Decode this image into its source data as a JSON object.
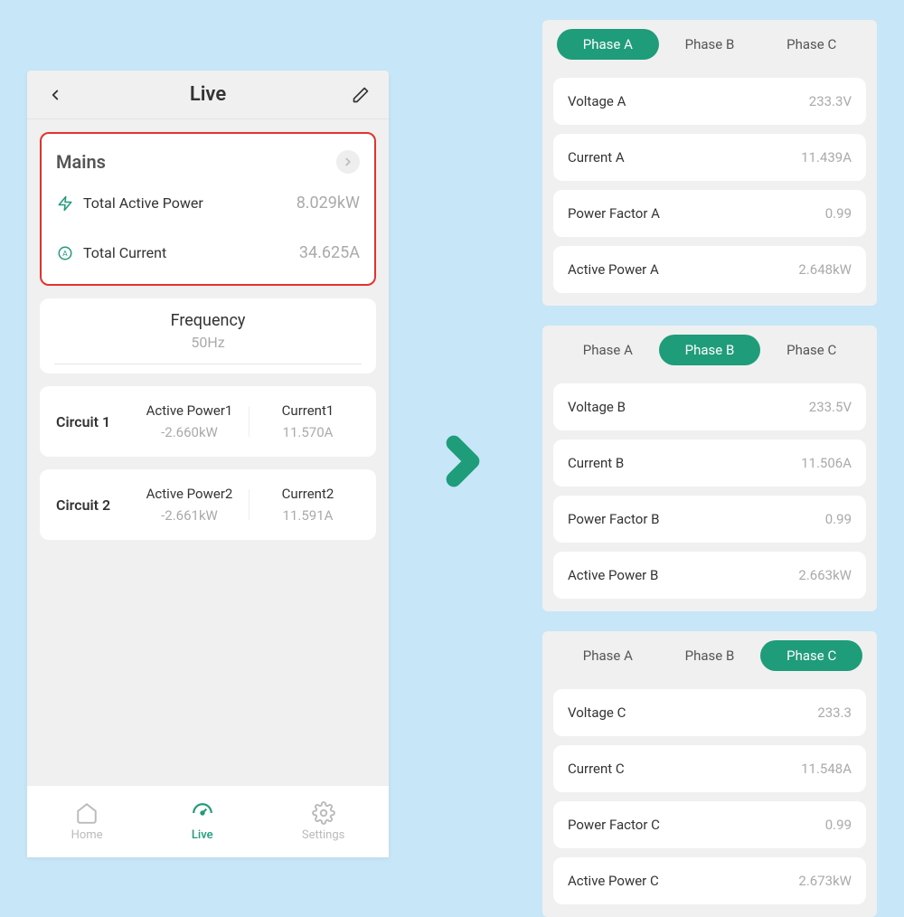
{
  "header": {
    "title": "Live"
  },
  "mains": {
    "title": "Mains",
    "active_power_label": "Total Active Power",
    "active_power_value": "8.029kW",
    "current_label": "Total Current",
    "current_value": "34.625A"
  },
  "frequency": {
    "label": "Frequency",
    "value": "50Hz"
  },
  "circuits": [
    {
      "name": "Circuit 1",
      "ap_label": "Active Power1",
      "ap_value": "-2.660kW",
      "c_label": "Current1",
      "c_value": "11.570A"
    },
    {
      "name": "Circuit 2",
      "ap_label": "Active Power2",
      "ap_value": "-2.661kW",
      "c_label": "Current2",
      "c_value": "11.591A"
    }
  ],
  "nav": {
    "home": "Home",
    "live": "Live",
    "settings": "Settings"
  },
  "phases": [
    {
      "tabs": [
        "Phase A",
        "Phase B",
        "Phase C"
      ],
      "active": 0,
      "rows": [
        {
          "label": "Voltage A",
          "value": "233.3V"
        },
        {
          "label": "Current A",
          "value": "11.439A"
        },
        {
          "label": "Power Factor A",
          "value": "0.99"
        },
        {
          "label": "Active Power A",
          "value": "2.648kW"
        }
      ]
    },
    {
      "tabs": [
        "Phase A",
        "Phase B",
        "Phase C"
      ],
      "active": 1,
      "rows": [
        {
          "label": "Voltage B",
          "value": "233.5V"
        },
        {
          "label": "Current B",
          "value": "11.506A"
        },
        {
          "label": "Power Factor B",
          "value": "0.99"
        },
        {
          "label": "Active Power B",
          "value": "2.663kW"
        }
      ]
    },
    {
      "tabs": [
        "Phase A",
        "Phase B",
        "Phase C"
      ],
      "active": 2,
      "rows": [
        {
          "label": "Voltage C",
          "value": "233.3"
        },
        {
          "label": "Current C",
          "value": "11.548A"
        },
        {
          "label": "Power Factor C",
          "value": "0.99"
        },
        {
          "label": "Active Power C",
          "value": "2.673kW"
        }
      ]
    }
  ]
}
